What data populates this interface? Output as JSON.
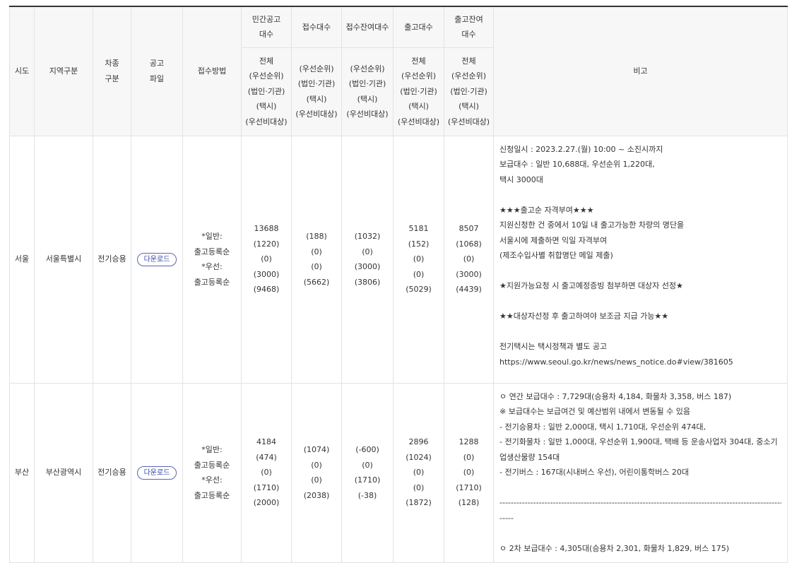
{
  "header": {
    "sido": "시도",
    "region": "지역구분",
    "car_type": [
      "차종",
      "구분"
    ],
    "notice_file": [
      "공고",
      "파일"
    ],
    "method": "접수방법",
    "private_notice": [
      "민간공고",
      "대수"
    ],
    "received": "접수대수",
    "remain": "접수잔여대수",
    "released": "출고대수",
    "release_remain": [
      "출고잔여",
      "대수"
    ],
    "remarks": "비고",
    "sub_full": [
      "전체",
      "(우선순위)",
      "(법인·기관)",
      "(택시)",
      "(우선비대상)"
    ],
    "sub_part": [
      "(우선순위)",
      "(법인·기관)",
      "(택시)",
      "(우선비대상)"
    ]
  },
  "rows": [
    {
      "sido": "서울",
      "region": "서울특별시",
      "car_type": "전기승용",
      "download_label": "다운로드",
      "method": [
        "*일반:",
        "출고등록순",
        "*우선:",
        "출고등록순"
      ],
      "private_notice": [
        "13688",
        "(1220)",
        "(0)",
        "(3000)",
        "(9468)"
      ],
      "received": [
        "(188)",
        "(0)",
        "(0)",
        "(5662)"
      ],
      "remain": [
        "(1032)",
        "(0)",
        "(3000)",
        "(3806)"
      ],
      "released": [
        "5181",
        "(152)",
        "(0)",
        "(0)",
        "(5029)"
      ],
      "release_remain": [
        "8507",
        "(1068)",
        "(0)",
        "(3000)",
        "(4439)"
      ],
      "remarks": [
        "신청일시 : 2023.2.27.(월) 10:00 ~ 소진시까지",
        "보급대수 : 일반 10,688대, 우선순위 1,220대,",
        "택시 3000대",
        "",
        "★★★출고순 자격부여★★★",
        "지원신청한 건 중에서 10일 내 출고가능한 차량의 명단을",
        "서울시에 제출하면 익일 자격부여",
        "(제조수입사별 취합명단 메일 제출)",
        "",
        "★지원가능요청 시 출고예정증빙 첨부하면 대상자 선정★",
        "",
        "★★대상자선정 후 출고하여야 보조금 지급 가능★★",
        "",
        "전기택시는 택시정책과 별도 공고",
        "https://www.seoul.go.kr/news/news_notice.do#view/381605"
      ]
    },
    {
      "sido": "부산",
      "region": "부산광역시",
      "car_type": "전기승용",
      "download_label": "다운로드",
      "method": [
        "*일반:",
        "출고등록순",
        "*우선:",
        "출고등록순"
      ],
      "private_notice": [
        "4184",
        "(474)",
        "(0)",
        "(1710)",
        "(2000)"
      ],
      "received": [
        "(1074)",
        "(0)",
        "(0)",
        "(2038)"
      ],
      "remain": [
        "(-600)",
        "(0)",
        "(1710)",
        "(-38)"
      ],
      "released": [
        "2896",
        "(1024)",
        "(0)",
        "(0)",
        "(1872)"
      ],
      "release_remain": [
        "1288",
        "(0)",
        "(0)",
        "(1710)",
        "(128)"
      ],
      "remarks": [
        "ㅇ 연간 보급대수 : 7,729대(승용차 4,184, 화물차 3,358, 버스 187)",
        "※ 보급대수는 보급여건 및 예산범위 내에서 변동될 수 있음",
        "- 전기승용차 : 일반 2,000대, 택시 1,710대, 우선순위 474대,",
        "- 전기화물차 : 일반 1,000대, 우선순위 1,900대, 택배 등 운송사업자 304대, 중소기업생산물량 154대",
        "- 전기버스 : 167대(시내버스 우선), 어린이통학버스 20대",
        "",
        "--------------------------------------------------------------------------------------------------------------------------------",
        "-----",
        "",
        "ㅇ 2차 보급대수 : 4,305대(승용차 2,301, 화물차 1,829, 버스 175)"
      ]
    }
  ]
}
